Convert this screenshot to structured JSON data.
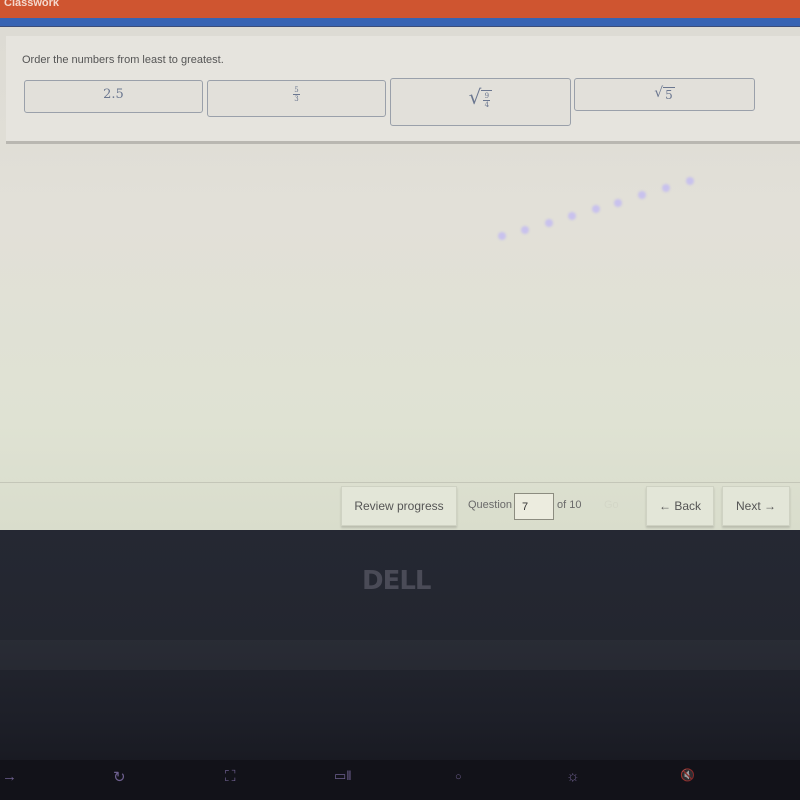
{
  "app": {
    "title": "Classwork",
    "colors": {
      "header": "#cf5530",
      "accent_bar": "#3763b3"
    }
  },
  "question": {
    "prompt": "Order the numbers from least to greatest.",
    "tiles": [
      {
        "id": "tile-2-5",
        "display": "2.5"
      },
      {
        "id": "tile-5-over-3",
        "numerator": "5",
        "denominator": "3"
      },
      {
        "id": "tile-sqrt-9-over-4",
        "radical": "√",
        "numerator": "9",
        "denominator": "4"
      },
      {
        "id": "tile-sqrt-5",
        "radical": "√",
        "radicand": "5"
      }
    ]
  },
  "nav": {
    "review_progress": "Review progress",
    "question_label": "Question",
    "question_value": "7",
    "of_total": "of 10",
    "go": "Go",
    "back": "← Back",
    "next": "Next →"
  },
  "device": {
    "brand": "DELL",
    "keys": [
      {
        "name": "forward-icon",
        "glyph": "→"
      },
      {
        "name": "refresh-icon",
        "glyph": "↻"
      },
      {
        "name": "fullscreen-icon",
        "glyph": "⛶"
      },
      {
        "name": "overview-icon",
        "glyph": "▭‖"
      },
      {
        "name": "brightness-down-icon",
        "glyph": "○"
      },
      {
        "name": "brightness-up-icon",
        "glyph": "☼"
      },
      {
        "name": "mute-icon",
        "glyph": "🔇"
      }
    ]
  }
}
